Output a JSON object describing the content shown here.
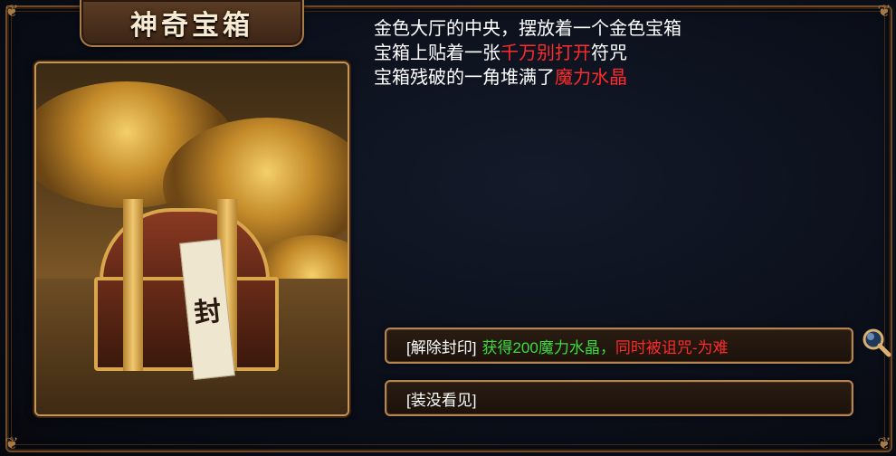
{
  "title": "神奇宝箱",
  "story": {
    "line1": "金色大厅的中央，摆放着一个金色宝箱",
    "line2_prefix": "宝箱上贴着一张",
    "line2_highlight": "千万别打开",
    "line2_suffix": "符咒",
    "line3_prefix": "宝箱残破的一角堆满了",
    "line3_highlight": "魔力水晶"
  },
  "art": {
    "seal_char": "封"
  },
  "options": {
    "opt1": {
      "tag": "[解除封印]",
      "reward": "获得200魔力水晶，",
      "penalty": "同时被诅咒-为难"
    },
    "opt2": {
      "tag": "[装没看见]"
    }
  },
  "icons": {
    "magnifier": "magnifier-icon"
  },
  "colors": {
    "highlight_red": "#ff2b2b",
    "reward_green": "#3ddc3d",
    "frame_gold": "#b58653"
  }
}
